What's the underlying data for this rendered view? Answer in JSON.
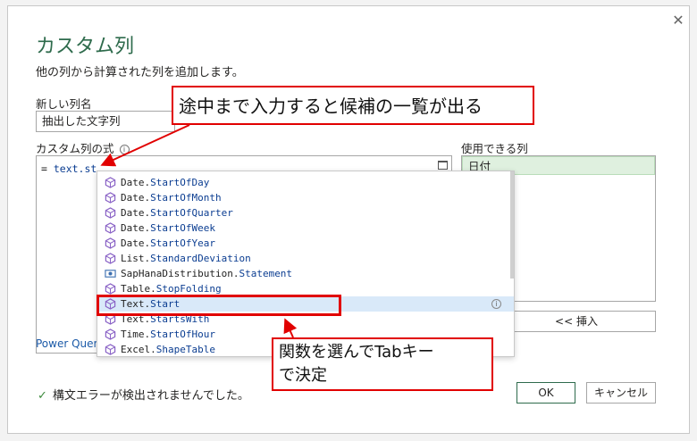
{
  "dialog": {
    "title": "カスタム列",
    "subtitle": "他の列から計算された列を追加します。",
    "new_column_label": "新しい列名",
    "new_column_value": "抽出した文字列",
    "formula_label": "カスタム列の式",
    "formula_prefix": "= ",
    "formula_typed": "text.st",
    "available_columns_label": "使用できる列",
    "available_columns": [
      "日付"
    ],
    "insert_button": "<< 挿入",
    "power_query_link": "Power Quer",
    "status_text": "構文エラーが検出されませんでした。",
    "ok_button": "OK",
    "cancel_button": "キャンセル",
    "close_icon": "close-icon"
  },
  "suggestions": [
    {
      "prefix": "Date.",
      "rest": "StartOfDay",
      "selected": false,
      "icon": "function-cube-icon"
    },
    {
      "prefix": "Date.",
      "rest": "StartOfMonth",
      "selected": false,
      "icon": "function-cube-icon"
    },
    {
      "prefix": "Date.",
      "rest": "StartOfQuarter",
      "selected": false,
      "icon": "function-cube-icon"
    },
    {
      "prefix": "Date.",
      "rest": "StartOfWeek",
      "selected": false,
      "icon": "function-cube-icon"
    },
    {
      "prefix": "Date.",
      "rest": "StartOfYear",
      "selected": false,
      "icon": "function-cube-icon"
    },
    {
      "prefix": "List.",
      "rest": "StandardDeviation",
      "selected": false,
      "icon": "function-cube-icon"
    },
    {
      "prefix": "SapHanaDistribution.",
      "rest": "Statement",
      "selected": false,
      "icon": "enum-icon"
    },
    {
      "prefix": "Table.",
      "rest": "StopFolding",
      "selected": false,
      "icon": "function-cube-icon"
    },
    {
      "prefix": "Text.",
      "rest": "Start",
      "selected": true,
      "icon": "function-cube-icon"
    },
    {
      "prefix": "Text.",
      "rest": "StartsWith",
      "selected": false,
      "icon": "function-cube-icon"
    },
    {
      "prefix": "Time.",
      "rest": "StartOfHour",
      "selected": false,
      "icon": "function-cube-icon"
    },
    {
      "prefix": "Excel.",
      "rest": "ShapeTable",
      "selected": false,
      "icon": "function-cube-icon"
    }
  ],
  "annotations": {
    "callout_top": "途中まで入力すると候補の一覧が出る",
    "callout_bottom_line1": "関数を選んでTabキー",
    "callout_bottom_line2": "で決定"
  },
  "colors": {
    "title": "#2e6b4c",
    "callout_border": "#e10000",
    "selected_row": "#d9e9f9",
    "column_highlight": "#dff0df",
    "icon_purple": "#8a63c6"
  }
}
